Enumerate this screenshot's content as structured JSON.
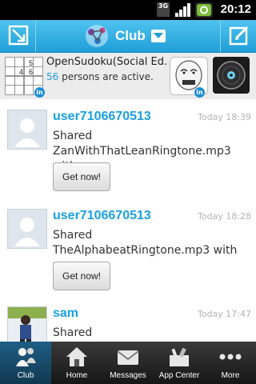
{
  "status_bar": {
    "network": "3G",
    "time": "20:12"
  },
  "header": {
    "title": "Club"
  },
  "banner": {
    "app_name": "OpenSudoku(Social Ed...",
    "active_count": "56",
    "active_text": " persons are active.",
    "sudoku_digits": [
      "5",
      "4",
      "6"
    ],
    "badge_text": "in"
  },
  "feed": [
    {
      "user": "user7106670513",
      "time": "Today 18:39",
      "message": "Shared ZanWithThatLeanRingtone.mp3 with you.",
      "button": "Get now!"
    },
    {
      "user": "user7106670513",
      "time": "Today 18:28",
      "message": "Shared TheAlphabeatRingtone.mp3 with you.",
      "button": "Get now!"
    },
    {
      "user": "sam",
      "time": "Today 17:47",
      "message": "Shared"
    }
  ],
  "tabs": [
    {
      "label": "Club",
      "icon": "club-icon"
    },
    {
      "label": "Home",
      "icon": "home-icon"
    },
    {
      "label": "Messages",
      "icon": "envelope-icon"
    },
    {
      "label": "App Center",
      "icon": "app-center-icon"
    },
    {
      "label": "More",
      "icon": "more-dots-icon"
    }
  ],
  "colors": {
    "accent": "#1aa0e0",
    "header_bg": "#34b3e8",
    "tabbar_bg": "#222222"
  }
}
